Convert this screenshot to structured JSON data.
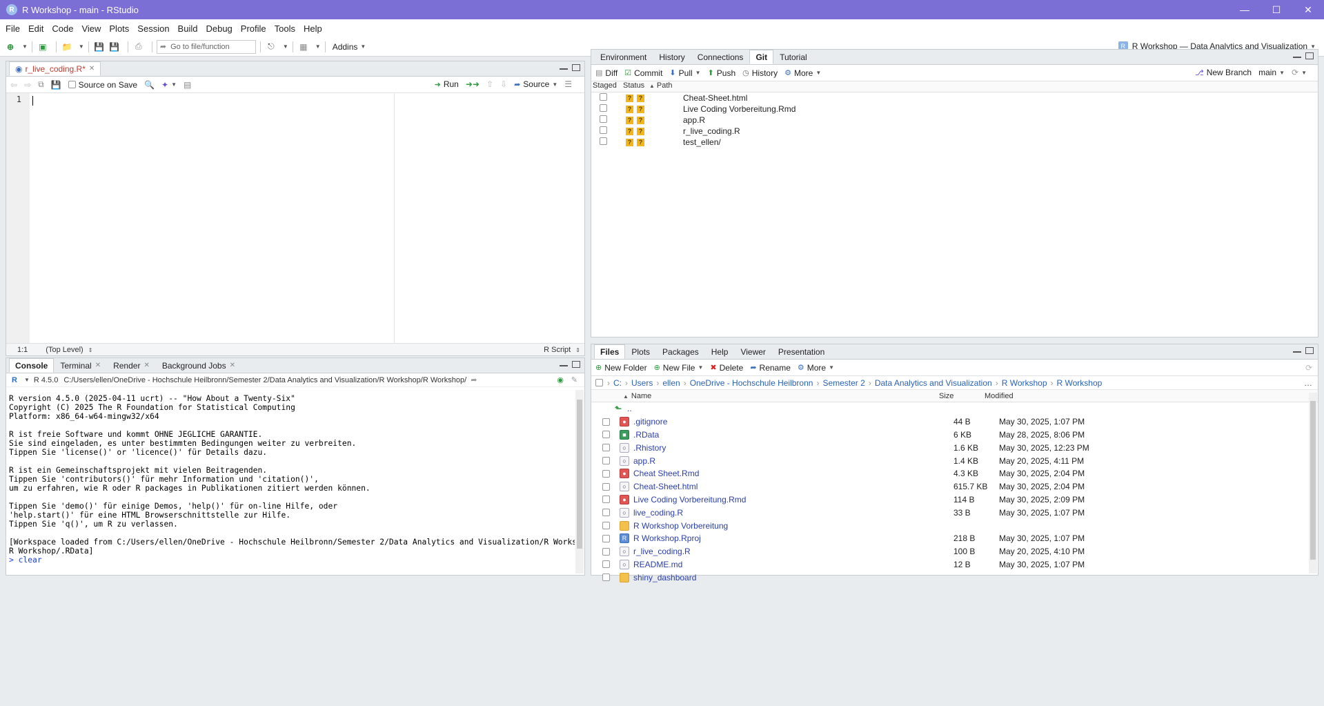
{
  "window": {
    "title": "R Workshop - main - RStudio",
    "app_icon": "R"
  },
  "menubar": [
    "File",
    "Edit",
    "Code",
    "View",
    "Plots",
    "Session",
    "Build",
    "Debug",
    "Profile",
    "Tools",
    "Help"
  ],
  "toolbar": {
    "goto_placeholder": "Go to file/function",
    "addins_label": "Addins",
    "project_label": "R Workshop — Data Analytics and Visualization"
  },
  "source": {
    "tab_label": "r_live_coding.R*",
    "source_on_save_label": "Source on Save",
    "run_label": "Run",
    "source_label": "Source",
    "line_number": "1",
    "cursor_pos": "1:1",
    "scope_label": "(Top Level)",
    "file_type": "R Script"
  },
  "console": {
    "tabs": [
      "Console",
      "Terminal",
      "Render",
      "Background Jobs"
    ],
    "r_version": "R 4.5.0",
    "path": "C:/Users/ellen/OneDrive - Hochschule Heilbronn/Semester 2/Data Analytics and Visualization/R Workshop/R Workshop/",
    "output": "R version 4.5.0 (2025-04-11 ucrt) -- \"How About a Twenty-Six\"\nCopyright (C) 2025 The R Foundation for Statistical Computing\nPlatform: x86_64-w64-mingw32/x64\n\nR ist freie Software und kommt OHNE JEGLICHE GARANTIE.\nSie sind eingeladen, es unter bestimmten Bedingungen weiter zu verbreiten.\nTippen Sie 'license()' or 'licence()' für Details dazu.\n\nR ist ein Gemeinschaftsprojekt mit vielen Beitragenden.\nTippen Sie 'contributors()' für mehr Information und 'citation()',\num zu erfahren, wie R oder R packages in Publikationen zitiert werden können.\n\nTippen Sie 'demo()' für einige Demos, 'help()' für on-line Hilfe, oder\n'help.start()' für eine HTML Browserschnittstelle zur Hilfe.\nTippen Sie 'q()', um R zu verlassen.\n\n[Workspace loaded from C:/Users/ellen/OneDrive - Hochschule Heilbronn/Semester 2/Data Analytics and Visualization/R Workshop/\nR Workshop/.RData]\n",
    "prompt": "> ",
    "command": "clear"
  },
  "env_pane": {
    "tabs": [
      "Environment",
      "History",
      "Connections",
      "Git",
      "Tutorial"
    ],
    "active_tab": "Git",
    "toolbar": {
      "diff": "Diff",
      "commit": "Commit",
      "pull": "Pull",
      "push": "Push",
      "history": "History",
      "more": "More",
      "new_branch": "New Branch",
      "branch": "main"
    },
    "columns": {
      "staged": "Staged",
      "status": "Status",
      "path": "Path"
    },
    "status_badge": "?",
    "files": [
      "Cheat-Sheet.html",
      "Live Coding Vorbereitung.Rmd",
      "app.R",
      "r_live_coding.R",
      "test_ellen/"
    ]
  },
  "files_pane": {
    "tabs": [
      "Files",
      "Plots",
      "Packages",
      "Help",
      "Viewer",
      "Presentation"
    ],
    "toolbar": {
      "new_folder": "New Folder",
      "new_file": "New File",
      "delete": "Delete",
      "rename": "Rename",
      "more": "More"
    },
    "breadcrumb": [
      "C:",
      "Users",
      "ellen",
      "OneDrive - Hochschule Heilbronn",
      "Semester 2",
      "Data Analytics and Visualization",
      "R Workshop",
      "R Workshop"
    ],
    "columns": {
      "name": "Name",
      "size": "Size",
      "modified": "Modified"
    },
    "parent_label": "..",
    "rows": [
      {
        "name": ".gitignore",
        "size": "44 B",
        "modified": "May 30, 2025, 1:07 PM",
        "icon": "red"
      },
      {
        "name": ".RData",
        "size": "6 KB",
        "modified": "May 28, 2025, 8:06 PM",
        "icon": "green"
      },
      {
        "name": ".Rhistory",
        "size": "1.6 KB",
        "modified": "May 30, 2025, 12:23 PM",
        "icon": "doc"
      },
      {
        "name": "app.R",
        "size": "1.4 KB",
        "modified": "May 20, 2025, 4:11 PM",
        "icon": "doc"
      },
      {
        "name": "Cheat Sheet.Rmd",
        "size": "4.3 KB",
        "modified": "May 30, 2025, 2:04 PM",
        "icon": "red"
      },
      {
        "name": "Cheat-Sheet.html",
        "size": "615.7 KB",
        "modified": "May 30, 2025, 2:04 PM",
        "icon": "doc"
      },
      {
        "name": "Live Coding Vorbereitung.Rmd",
        "size": "114 B",
        "modified": "May 30, 2025, 2:09 PM",
        "icon": "red"
      },
      {
        "name": "live_coding.R",
        "size": "33 B",
        "modified": "May 30, 2025, 1:07 PM",
        "icon": "doc"
      },
      {
        "name": "R Workshop Vorbereitung",
        "size": "",
        "modified": "",
        "icon": "folder"
      },
      {
        "name": "R Workshop.Rproj",
        "size": "218 B",
        "modified": "May 30, 2025, 1:07 PM",
        "icon": "blue"
      },
      {
        "name": "r_live_coding.R",
        "size": "100 B",
        "modified": "May 20, 2025, 4:10 PM",
        "icon": "doc"
      },
      {
        "name": "README.md",
        "size": "12 B",
        "modified": "May 30, 2025, 1:07 PM",
        "icon": "doc"
      },
      {
        "name": "shiny_dashboard",
        "size": "",
        "modified": "",
        "icon": "folder"
      }
    ]
  }
}
